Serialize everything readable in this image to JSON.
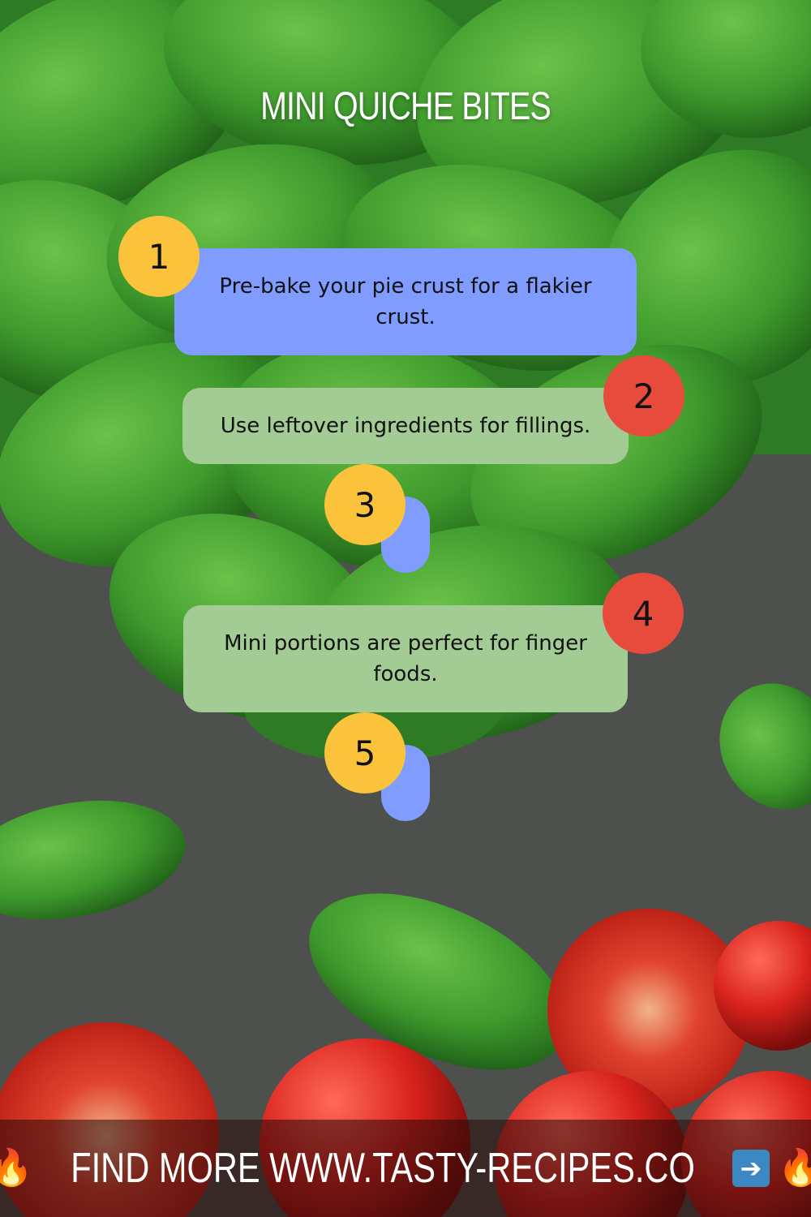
{
  "title": "MINI QUICHE BITES",
  "steps": [
    {
      "number": "1",
      "text": "Pre-bake your pie crust for a flakier crust."
    },
    {
      "number": "2",
      "text": "Use leftover ingredients for fillings."
    },
    {
      "number": "3",
      "text": ""
    },
    {
      "number": "4",
      "text": "Mini portions are perfect for finger foods."
    },
    {
      "number": "5",
      "text": ""
    }
  ],
  "footer": {
    "left_icon": "fire-icon",
    "text": "FIND MORE WWW.TASTY-RECIPES.CO",
    "arrow_icon": "right-arrow-icon",
    "right_icon": "fire-icon"
  },
  "colors": {
    "card_blue": "#809cff",
    "card_green": "#a3cb94",
    "badge_yellow": "#fbc23c",
    "badge_red": "#e64b3b"
  }
}
